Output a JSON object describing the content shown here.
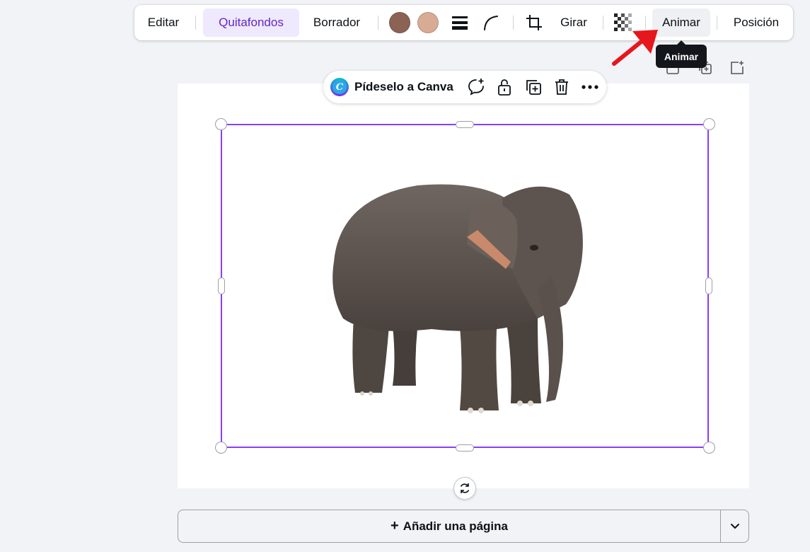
{
  "toolbar": {
    "edit_label": "Editar",
    "remove_bg_label": "Quitafondos",
    "eraser_label": "Borrador",
    "color_1": "#8a6354",
    "color_2": "#d8ab95",
    "border_style_icon": "lines-icon",
    "corner_rounding_icon": "curve-icon",
    "crop_icon": "crop-icon",
    "rotate_label": "Girar",
    "transparency_icon": "checkerboard-icon",
    "animate_label": "Animar",
    "position_label": "Posición"
  },
  "tooltip": {
    "text": "Animar"
  },
  "context_bar": {
    "ask_canva_label": "Pídeselo a Canva",
    "logo_letter": "C",
    "icons": [
      "comment-add-icon",
      "lock-icon",
      "duplicate-icon",
      "trash-icon",
      "more-icon"
    ]
  },
  "page_icons": [
    "page-up-icon",
    "duplicate-page-icon",
    "add-page-icon"
  ],
  "canvas": {
    "image": "elephant",
    "selection_color": "#8b3dff"
  },
  "add_page": {
    "label": "Añadir una página",
    "plus": "+"
  }
}
